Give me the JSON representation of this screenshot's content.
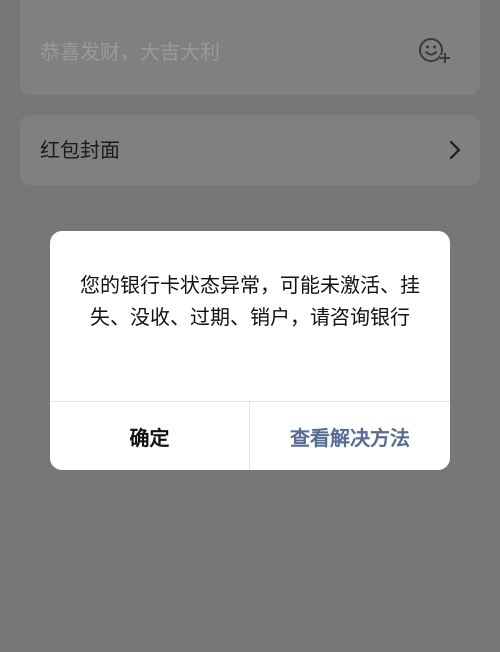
{
  "message_field": {
    "placeholder": "恭喜发财，大吉大利",
    "emoji_icon": "emoji-add-icon"
  },
  "cover_row": {
    "label": "红包封面",
    "chevron_icon": "chevron-right-icon"
  },
  "dialog": {
    "message": "您的银行卡状态异常，可能未激活、挂失、没收、过期、销户，请咨询银行",
    "confirm_label": "确定",
    "solution_label": "查看解决方法",
    "colors": {
      "link": "#576b95",
      "text": "#111111",
      "background": "#ffffff"
    }
  },
  "overlay_color": "#777777"
}
